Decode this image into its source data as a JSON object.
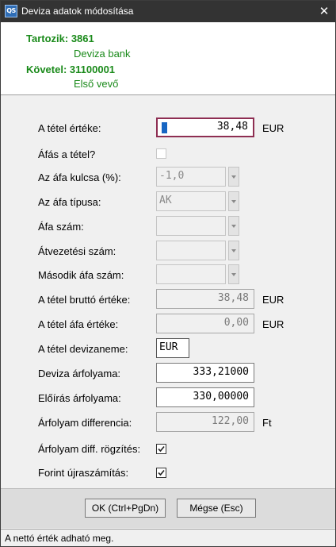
{
  "window": {
    "title": "Deviza adatok módosítása",
    "icon_text": "QS",
    "close_symbol": "✕"
  },
  "header": {
    "debit_label": "Tartozik: 3861",
    "debit_name": "Deviza bank",
    "credit_label": "Követel: 31100001",
    "credit_name": "Első vevő",
    "text_color": "#1a8a1a"
  },
  "form": {
    "item_value": {
      "label": "A tétel értéke:",
      "value": "38,48",
      "unit": "EUR"
    },
    "vat_item": {
      "label": "Áfás a tétel?",
      "checked": false
    },
    "vat_rate": {
      "label": "Az áfa kulcsa (%):",
      "value": "-1,0"
    },
    "vat_type": {
      "label": "Az áfa típusa:",
      "value": "AK"
    },
    "vat_number": {
      "label": "Áfa szám:",
      "value": ""
    },
    "transfer_number": {
      "label": "Átvezetési szám:",
      "value": ""
    },
    "second_vat_number": {
      "label": "Második áfa szám:",
      "value": ""
    },
    "gross_value": {
      "label": "A tétel bruttó értéke:",
      "value": "38,48",
      "unit": "EUR"
    },
    "vat_value": {
      "label": "A tétel áfa értéke:",
      "value": "0,00",
      "unit": "EUR"
    },
    "currency": {
      "label": "A tétel devizaneme:",
      "value": "EUR"
    },
    "exchange_rate": {
      "label": "Deviza árfolyama:",
      "value": "333,21000"
    },
    "prescribed_rate": {
      "label": "Előírás árfolyama:",
      "value": "330,00000"
    },
    "rate_difference": {
      "label": "Árfolyam differencia:",
      "value": "122,00",
      "unit": "Ft"
    },
    "record_difference": {
      "label": "Árfolyam diff. rögzítés:",
      "checked": true
    },
    "huf_recalc": {
      "label": "Forint újraszámítás:",
      "checked": true
    }
  },
  "buttons": {
    "ok": "OK (Ctrl+PgDn)",
    "cancel": "Mégse (Esc)"
  },
  "status": "A nettó érték adható meg.",
  "colors": {
    "titlebar": "#333333",
    "focus_border": "#8e2e52",
    "caret": "#1766c3"
  },
  "icons": {
    "app": "app-icon",
    "close": "close-icon",
    "check": "checkmark",
    "dropdown": "chevron-down-icon"
  }
}
